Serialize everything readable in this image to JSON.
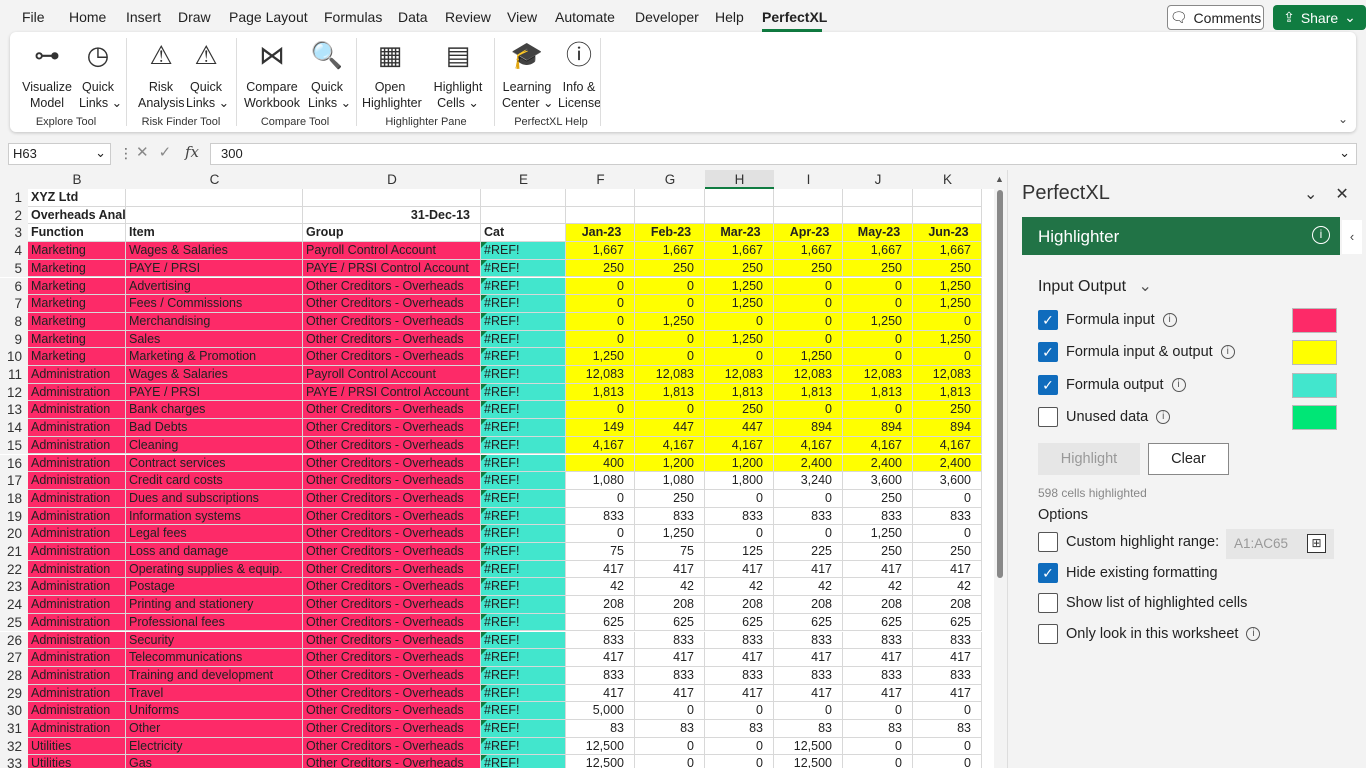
{
  "menu": [
    "File",
    "Home",
    "Insert",
    "Draw",
    "Page Layout",
    "Formulas",
    "Data",
    "Review",
    "View",
    "Automate",
    "Developer",
    "Help",
    "PerfectXL"
  ],
  "top_buttons": {
    "comments": "Comments",
    "share": "Share"
  },
  "ribbon": {
    "buttons": [
      {
        "label": "Visualize\nModel",
        "icon": "visualize-model-icon"
      },
      {
        "label": "Quick\nLinks ⌄",
        "icon": "compass-icon"
      },
      {
        "label": "Risk\nAnalysis",
        "icon": "risk-analysis-icon"
      },
      {
        "label": "Quick\nLinks ⌄",
        "icon": "warning-icon"
      },
      {
        "label": "Compare\nWorkbook",
        "icon": "compare-workbook-icon"
      },
      {
        "label": "Quick\nLinks ⌄",
        "icon": "magnifier-icon"
      },
      {
        "label": "Open\nHighlighter",
        "icon": "highlighter-icon"
      },
      {
        "label": "Highlight\nCells ⌄",
        "icon": "highlight-cells-icon"
      },
      {
        "label": "Learning\nCenter ⌄",
        "icon": "graduation-cap-icon"
      },
      {
        "label": "Info &\nLicense",
        "icon": "info-icon"
      }
    ],
    "groups": [
      "Explore Tool",
      "Risk Finder Tool",
      "Compare Tool",
      "Highlighter Pane",
      "PerfectXL Help"
    ]
  },
  "formula_bar": {
    "name_box": "H63",
    "value": "300"
  },
  "columns": [
    "B",
    "C",
    "D",
    "E",
    "F",
    "G",
    "H",
    "I",
    "J",
    "K"
  ],
  "header_rows": [
    {
      "n": "1",
      "b": "XYZ Ltd",
      "c": "",
      "d": "",
      "e": "",
      "f": "",
      "g": "",
      "h": "",
      "i": "",
      "j": "",
      "k": ""
    },
    {
      "n": "2",
      "b": "Overheads Analysis for the year ending",
      "c": "",
      "d": "31-Dec-13",
      "e": "",
      "f": "",
      "g": "",
      "h": "",
      "i": "",
      "j": "",
      "k": ""
    },
    {
      "n": "3",
      "b": "Function",
      "c": "Item",
      "d": "Group",
      "e": "Cat",
      "f": "Jan-23",
      "g": "Feb-23",
      "h": "Mar-23",
      "i": "Apr-23",
      "j": "May-23",
      "k": "Jun-23"
    }
  ],
  "rows": [
    {
      "n": "4",
      "b": "Marketing",
      "c": "Wages & Salaries",
      "d": "Payroll Control Account",
      "e": "#REF!",
      "f": "1,667",
      "g": "1,667",
      "h": "1,667",
      "i": "1,667",
      "j": "1,667",
      "k": "1,667",
      "hl": true
    },
    {
      "n": "5",
      "b": "Marketing",
      "c": "PAYE / PRSI",
      "d": "PAYE / PRSI Control Account",
      "e": "#REF!",
      "f": "250",
      "g": "250",
      "h": "250",
      "i": "250",
      "j": "250",
      "k": "250",
      "hl": true
    },
    {
      "n": "6",
      "b": "Marketing",
      "c": "Advertising",
      "d": "Other Creditors - Overheads",
      "e": "#REF!",
      "f": "0",
      "g": "0",
      "h": "1,250",
      "i": "0",
      "j": "0",
      "k": "1,250",
      "hl": true
    },
    {
      "n": "7",
      "b": "Marketing",
      "c": "Fees / Commissions",
      "d": "Other Creditors - Overheads",
      "e": "#REF!",
      "f": "0",
      "g": "0",
      "h": "1,250",
      "i": "0",
      "j": "0",
      "k": "1,250",
      "hl": true
    },
    {
      "n": "8",
      "b": "Marketing",
      "c": "Merchandising",
      "d": "Other Creditors - Overheads",
      "e": "#REF!",
      "f": "0",
      "g": "1,250",
      "h": "0",
      "i": "0",
      "j": "1,250",
      "k": "0",
      "hl": true
    },
    {
      "n": "9",
      "b": "Marketing",
      "c": "Sales",
      "d": "Other Creditors - Overheads",
      "e": "#REF!",
      "f": "0",
      "g": "0",
      "h": "1,250",
      "i": "0",
      "j": "0",
      "k": "1,250",
      "hl": true
    },
    {
      "n": "10",
      "b": "Marketing",
      "c": "Marketing & Promotion",
      "d": "Other Creditors - Overheads",
      "e": "#REF!",
      "f": "1,250",
      "g": "0",
      "h": "0",
      "i": "1,250",
      "j": "0",
      "k": "0",
      "hl": true
    },
    {
      "n": "11",
      "b": "Administration",
      "c": "Wages & Salaries",
      "d": "Payroll Control Account",
      "e": "#REF!",
      "f": "12,083",
      "g": "12,083",
      "h": "12,083",
      "i": "12,083",
      "j": "12,083",
      "k": "12,083",
      "hl": true
    },
    {
      "n": "12",
      "b": "Administration",
      "c": "PAYE / PRSI",
      "d": "PAYE / PRSI Control Account",
      "e": "#REF!",
      "f": "1,813",
      "g": "1,813",
      "h": "1,813",
      "i": "1,813",
      "j": "1,813",
      "k": "1,813",
      "hl": true
    },
    {
      "n": "13",
      "b": "Administration",
      "c": "Bank charges",
      "d": "Other Creditors - Overheads",
      "e": "#REF!",
      "f": "0",
      "g": "0",
      "h": "250",
      "i": "0",
      "j": "0",
      "k": "250",
      "hl": true
    },
    {
      "n": "14",
      "b": "Administration",
      "c": "Bad Debts",
      "d": "Other Creditors - Overheads",
      "e": "#REF!",
      "f": "149",
      "g": "447",
      "h": "447",
      "i": "894",
      "j": "894",
      "k": "894",
      "hl": true
    },
    {
      "n": "15",
      "b": "Administration",
      "c": "Cleaning",
      "d": "Other Creditors - Overheads",
      "e": "#REF!",
      "f": "4,167",
      "g": "4,167",
      "h": "4,167",
      "i": "4,167",
      "j": "4,167",
      "k": "4,167",
      "hl": true
    },
    {
      "n": "16",
      "b": "Administration",
      "c": "Contract services",
      "d": "Other Creditors - Overheads",
      "e": "#REF!",
      "f": "400",
      "g": "1,200",
      "h": "1,200",
      "i": "2,400",
      "j": "2,400",
      "k": "2,400",
      "hl": true
    },
    {
      "n": "17",
      "b": "Administration",
      "c": "Credit card costs",
      "d": "Other Creditors - Overheads",
      "e": "#REF!",
      "f": "1,080",
      "g": "1,080",
      "h": "1,800",
      "i": "3,240",
      "j": "3,600",
      "k": "3,600",
      "hl": false
    },
    {
      "n": "18",
      "b": "Administration",
      "c": "Dues and subscriptions",
      "d": "Other Creditors - Overheads",
      "e": "#REF!",
      "f": "0",
      "g": "250",
      "h": "0",
      "i": "0",
      "j": "250",
      "k": "0",
      "hl": false
    },
    {
      "n": "19",
      "b": "Administration",
      "c": "Information systems",
      "d": "Other Creditors - Overheads",
      "e": "#REF!",
      "f": "833",
      "g": "833",
      "h": "833",
      "i": "833",
      "j": "833",
      "k": "833",
      "hl": false
    },
    {
      "n": "20",
      "b": "Administration",
      "c": "Legal fees",
      "d": "Other Creditors - Overheads",
      "e": "#REF!",
      "f": "0",
      "g": "1,250",
      "h": "0",
      "i": "0",
      "j": "1,250",
      "k": "0",
      "hl": false
    },
    {
      "n": "21",
      "b": "Administration",
      "c": "Loss and damage",
      "d": "Other Creditors - Overheads",
      "e": "#REF!",
      "f": "75",
      "g": "75",
      "h": "125",
      "i": "225",
      "j": "250",
      "k": "250",
      "hl": false
    },
    {
      "n": "22",
      "b": "Administration",
      "c": "Operating supplies & equip.",
      "d": "Other Creditors - Overheads",
      "e": "#REF!",
      "f": "417",
      "g": "417",
      "h": "417",
      "i": "417",
      "j": "417",
      "k": "417",
      "hl": false
    },
    {
      "n": "23",
      "b": "Administration",
      "c": "Postage",
      "d": "Other Creditors - Overheads",
      "e": "#REF!",
      "f": "42",
      "g": "42",
      "h": "42",
      "i": "42",
      "j": "42",
      "k": "42",
      "hl": false
    },
    {
      "n": "24",
      "b": "Administration",
      "c": "Printing and stationery",
      "d": "Other Creditors - Overheads",
      "e": "#REF!",
      "f": "208",
      "g": "208",
      "h": "208",
      "i": "208",
      "j": "208",
      "k": "208",
      "hl": false
    },
    {
      "n": "25",
      "b": "Administration",
      "c": "Professional fees",
      "d": "Other Creditors - Overheads",
      "e": "#REF!",
      "f": "625",
      "g": "625",
      "h": "625",
      "i": "625",
      "j": "625",
      "k": "625",
      "hl": false
    },
    {
      "n": "26",
      "b": "Administration",
      "c": "Security",
      "d": "Other Creditors - Overheads",
      "e": "#REF!",
      "f": "833",
      "g": "833",
      "h": "833",
      "i": "833",
      "j": "833",
      "k": "833",
      "hl": false
    },
    {
      "n": "27",
      "b": "Administration",
      "c": "Telecommunications",
      "d": "Other Creditors - Overheads",
      "e": "#REF!",
      "f": "417",
      "g": "417",
      "h": "417",
      "i": "417",
      "j": "417",
      "k": "417",
      "hl": false
    },
    {
      "n": "28",
      "b": "Administration",
      "c": "Training and development",
      "d": "Other Creditors - Overheads",
      "e": "#REF!",
      "f": "833",
      "g": "833",
      "h": "833",
      "i": "833",
      "j": "833",
      "k": "833",
      "hl": false
    },
    {
      "n": "29",
      "b": "Administration",
      "c": "Travel",
      "d": "Other Creditors - Overheads",
      "e": "#REF!",
      "f": "417",
      "g": "417",
      "h": "417",
      "i": "417",
      "j": "417",
      "k": "417",
      "hl": false
    },
    {
      "n": "30",
      "b": "Administration",
      "c": "Uniforms",
      "d": "Other Creditors - Overheads",
      "e": "#REF!",
      "f": "5,000",
      "g": "0",
      "h": "0",
      "i": "0",
      "j": "0",
      "k": "0",
      "hl": false
    },
    {
      "n": "31",
      "b": "Administration",
      "c": "Other",
      "d": "Other Creditors - Overheads",
      "e": "#REF!",
      "f": "83",
      "g": "83",
      "h": "83",
      "i": "83",
      "j": "83",
      "k": "83",
      "hl": false
    },
    {
      "n": "32",
      "b": "Utilities",
      "c": "Electricity",
      "d": "Other Creditors - Overheads",
      "e": "#REF!",
      "f": "12,500",
      "g": "0",
      "h": "0",
      "i": "12,500",
      "j": "0",
      "k": "0",
      "hl": false
    },
    {
      "n": "33",
      "b": "Utilities",
      "c": "Gas",
      "d": "Other Creditors - Overheads",
      "e": "#REF!",
      "f": "12,500",
      "g": "0",
      "h": "0",
      "i": "12,500",
      "j": "0",
      "k": "0",
      "hl": false
    }
  ],
  "pane": {
    "title": "PerfectXL",
    "section": "Highlighter",
    "mode": "Input Output",
    "checkboxes": [
      {
        "label": "Formula input",
        "checked": true,
        "info": true,
        "color": "#fd2a68"
      },
      {
        "label": "Formula input & output",
        "checked": true,
        "info": true,
        "color": "#ffff00"
      },
      {
        "label": "Formula output",
        "checked": true,
        "info": true,
        "color": "#42e6cd"
      },
      {
        "label": "Unused data",
        "checked": false,
        "info": true,
        "color": "#00e676"
      }
    ],
    "highlight_btn": "Highlight",
    "clear_btn": "Clear",
    "count": "598 cells highlighted",
    "options_label": "Options",
    "options": [
      {
        "label": "Custom highlight range:",
        "checked": false,
        "info": false
      },
      {
        "label": "Hide existing formatting",
        "checked": true,
        "info": false
      },
      {
        "label": "Show list of highlighted cells",
        "checked": false,
        "info": false
      },
      {
        "label": "Only look in this worksheet",
        "checked": false,
        "info": true
      }
    ],
    "range_value": "A1:AC65"
  }
}
